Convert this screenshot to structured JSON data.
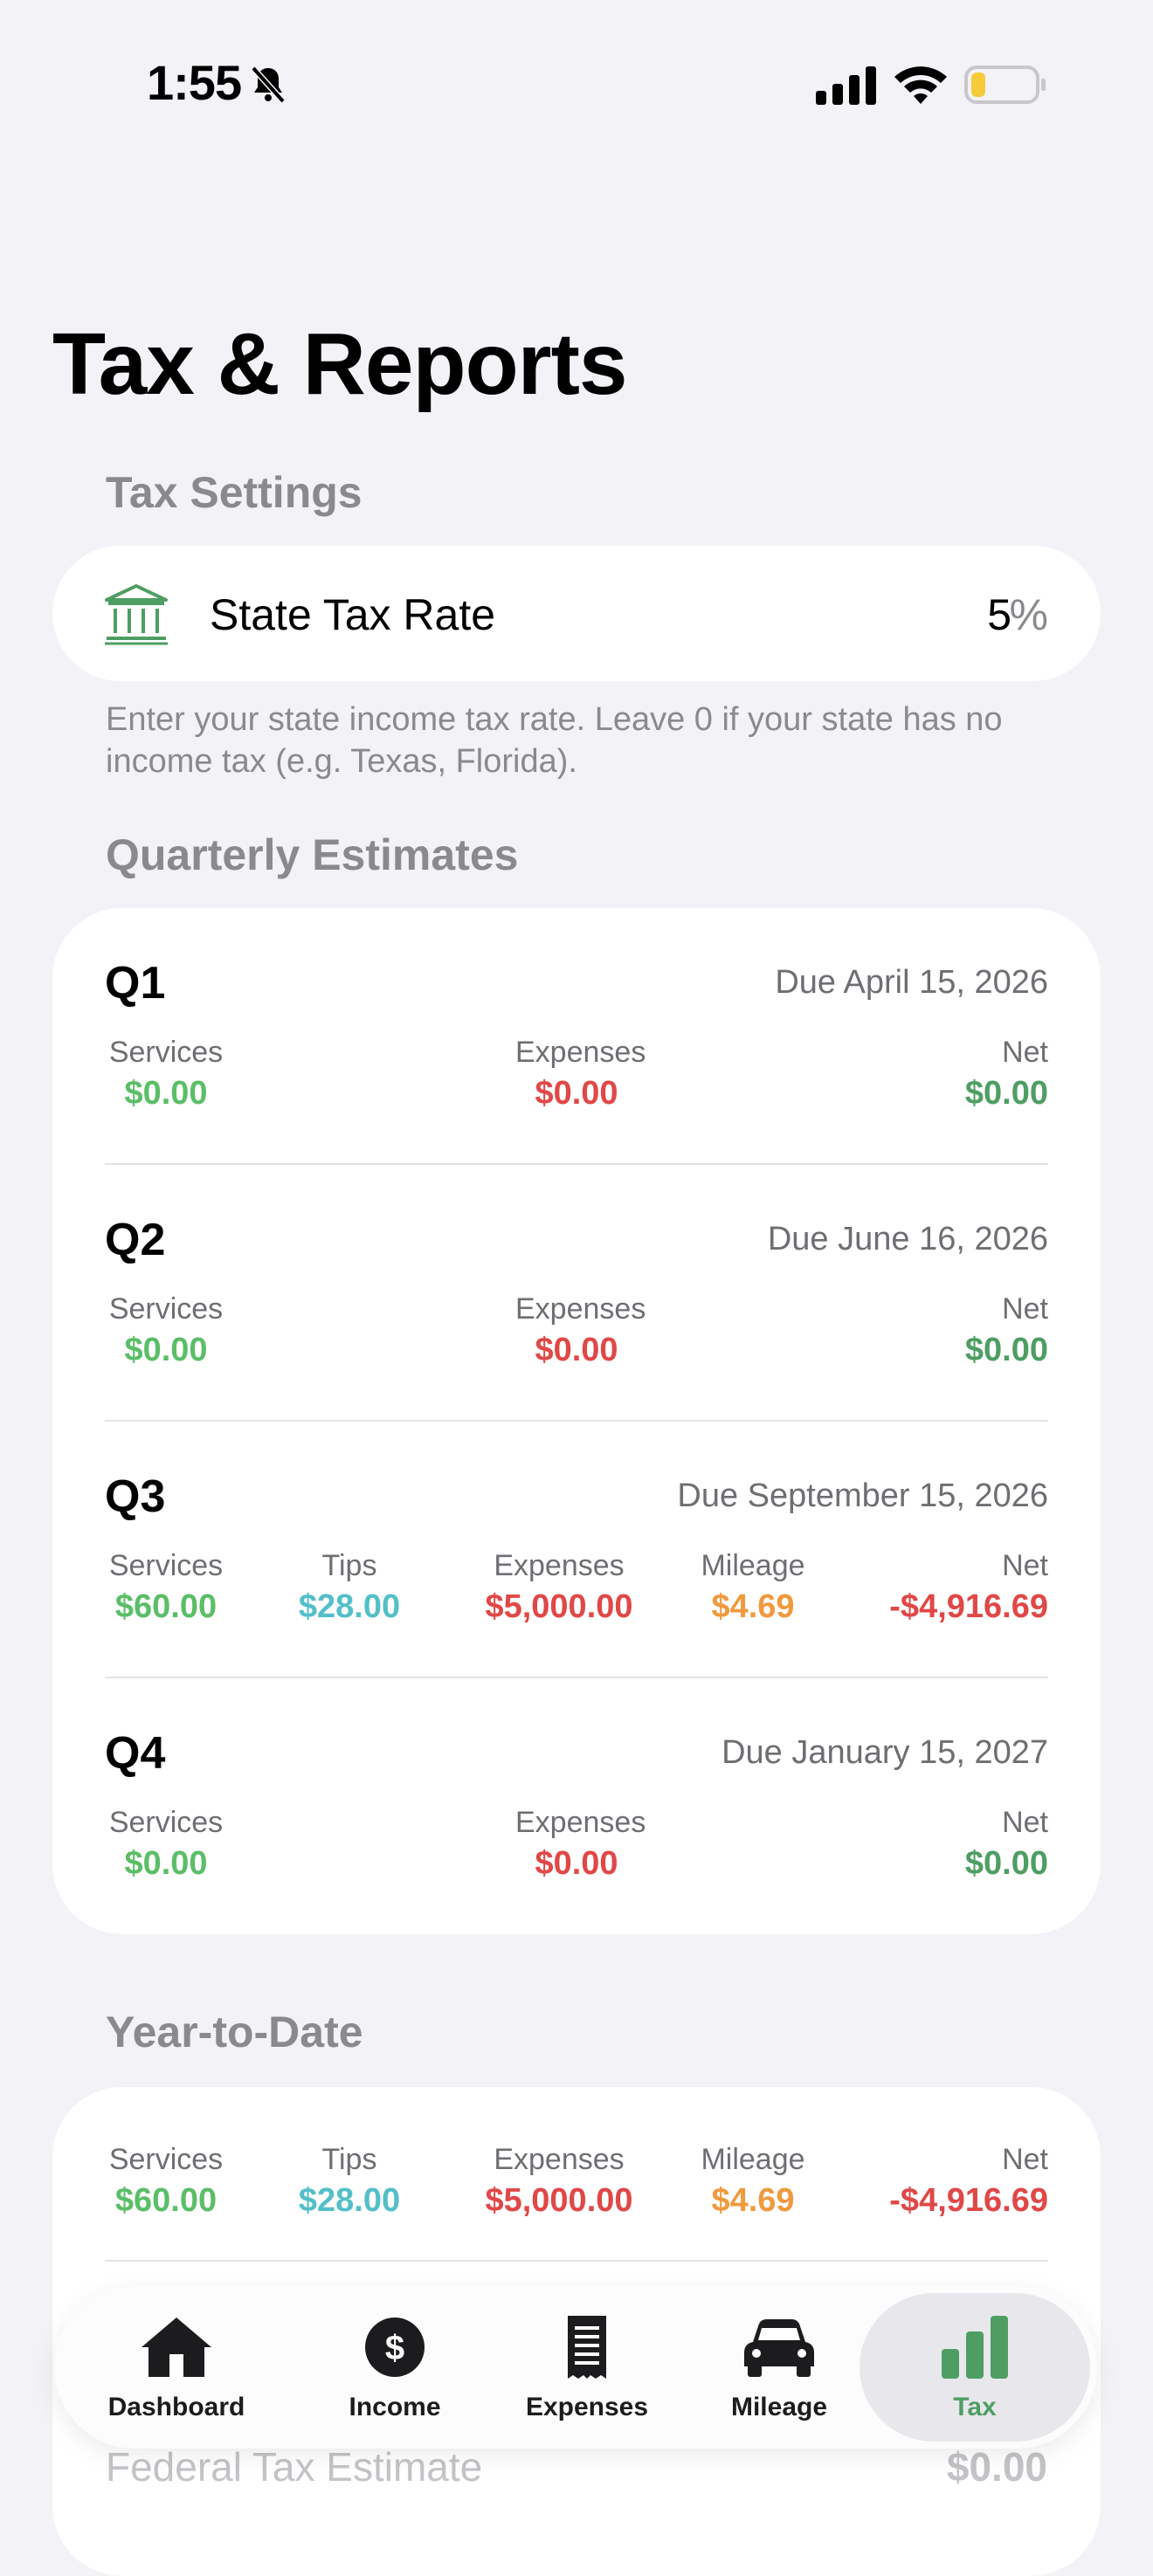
{
  "status_bar": {
    "time": "1:55"
  },
  "page_title": "Tax & Reports",
  "tax_settings": {
    "section_title": "Tax Settings",
    "state_tax": {
      "label": "State Tax Rate",
      "value": "5",
      "unit": "%"
    },
    "footnote": "Enter your state income tax rate. Leave 0 if your state has no income tax (e.g. Texas, Florida)."
  },
  "quarterly": {
    "section_title": "Quarterly Estimates",
    "quarters": [
      {
        "name": "Q1",
        "due": "Due April 15, 2026",
        "services_label": "Services",
        "services": "$0.00",
        "expenses_label": "Expenses",
        "expenses": "$0.00",
        "net_label": "Net",
        "net": "$0.00"
      },
      {
        "name": "Q2",
        "due": "Due June 16, 2026",
        "services_label": "Services",
        "services": "$0.00",
        "expenses_label": "Expenses",
        "expenses": "$0.00",
        "net_label": "Net",
        "net": "$0.00"
      },
      {
        "name": "Q3",
        "due": "Due September 15, 2026",
        "services_label": "Services",
        "services": "$60.00",
        "tips_label": "Tips",
        "tips": "$28.00",
        "expenses_label": "Expenses",
        "expenses": "$5,000.00",
        "mileage_label": "Mileage",
        "mileage": "$4.69",
        "net_label": "Net",
        "net": "-$4,916.69"
      },
      {
        "name": "Q4",
        "due": "Due January 15, 2027",
        "services_label": "Services",
        "services": "$0.00",
        "expenses_label": "Expenses",
        "expenses": "$0.00",
        "net_label": "Net",
        "net": "$0.00"
      }
    ]
  },
  "ytd": {
    "section_title": "Year-to-Date",
    "services_label": "Services",
    "services": "$60.00",
    "tips_label": "Tips",
    "tips": "$28.00",
    "expenses_label": "Expenses",
    "expenses": "$5,000.00",
    "mileage_label": "Mileage",
    "mileage": "$4.69",
    "net_label": "Net",
    "net": "-$4,916.69",
    "federal_label": "Federal Tax Estimate",
    "federal_value": "$0.00"
  },
  "tabs": [
    {
      "label": "Dashboard",
      "icon": "house-icon"
    },
    {
      "label": "Income",
      "icon": "dollar-circle-icon"
    },
    {
      "label": "Expenses",
      "icon": "receipt-icon"
    },
    {
      "label": "Mileage",
      "icon": "car-icon"
    },
    {
      "label": "Tax",
      "icon": "bar-chart-icon",
      "active": true
    }
  ],
  "colors": {
    "services": "#5BBE68",
    "tips": "#53BFC9",
    "expenses": "#E04848",
    "mileage": "#F09A3E",
    "net_positive": "#4E9E63",
    "net_negative": "#E04848",
    "accent": "#4E9E63"
  }
}
